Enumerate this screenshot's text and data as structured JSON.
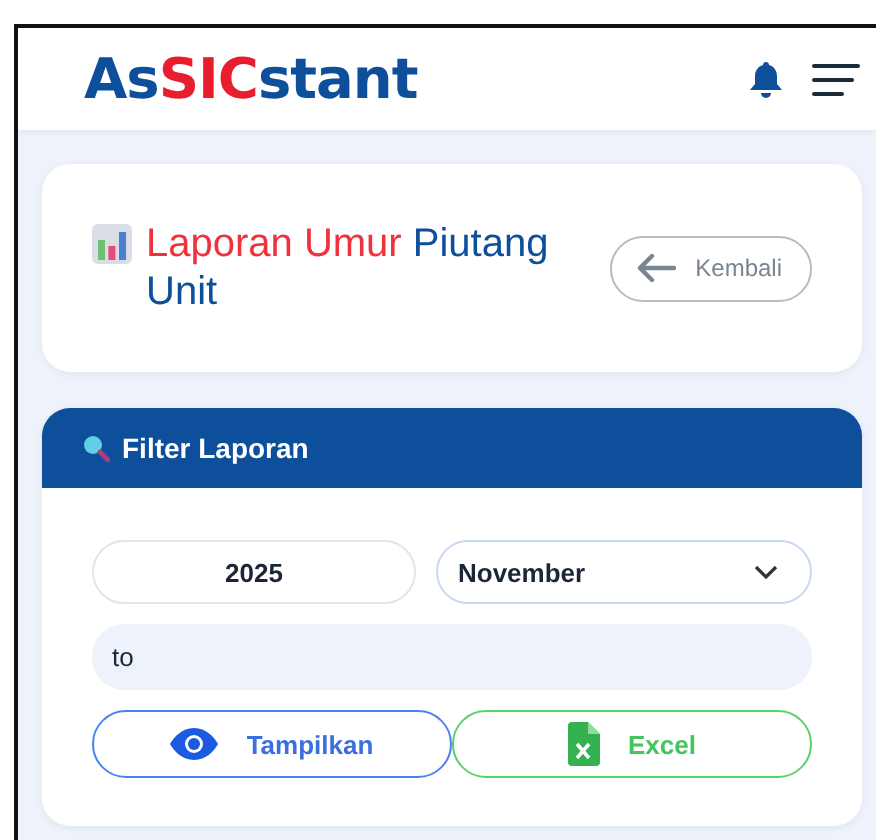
{
  "header": {
    "logo": [
      {
        "text": "As",
        "kind": "plain"
      },
      {
        "text": "SIC",
        "kind": "accent"
      },
      {
        "text": "stant",
        "kind": "plain"
      }
    ]
  },
  "page_title": {
    "parts": [
      {
        "text": "Laporan Umur",
        "kind": "accent"
      },
      {
        "text": " Piutang Unit",
        "kind": "plain"
      }
    ],
    "back_button": "Kembali"
  },
  "filter": {
    "title": "Filter Laporan",
    "year": "2025",
    "month": "November",
    "range": "to",
    "buttons": [
      {
        "label": "Tampilkan",
        "kind": "show"
      },
      {
        "label": "Excel",
        "kind": "excel"
      }
    ]
  }
}
